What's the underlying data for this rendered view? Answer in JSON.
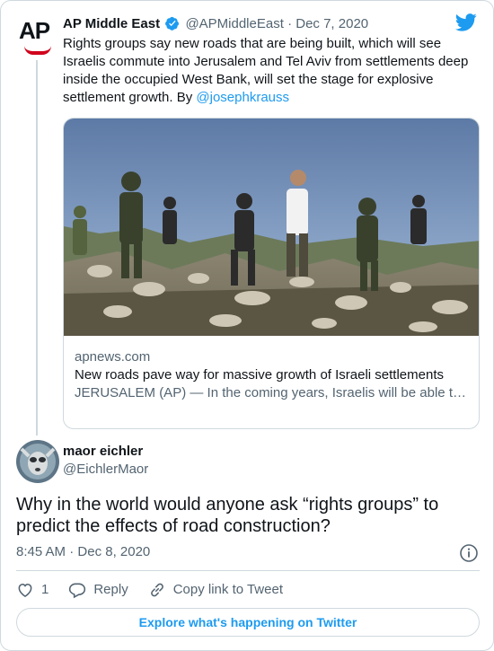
{
  "parent_tweet": {
    "display_name": "AP Middle East",
    "logo_text": "AP",
    "handle": "@APMiddleEast",
    "separator": "·",
    "date": "Dec 7, 2020",
    "text": "Rights groups say new roads that are being built, which will see Israelis commute into Jerusalem and Tel Aviv from settlements deep inside the occupied West Bank, will set the stage for explosive settlement growth. By ",
    "mention": "@josephkrauss",
    "link_card": {
      "domain": "apnews.com",
      "title": "New roads pave way for massive growth of Israeli settlements",
      "description": "JERUSALEM (AP) — In the coming years, Israelis will be able to commute into Jerusalem and Tel Aviv from settlements deep inside the occupied West Bank, will set the stage for explosive settlement growth."
    }
  },
  "tweet": {
    "display_name": "maor eichler",
    "handle": "@EichlerMaor",
    "text": "Why in the world would anyone ask “rights groups” to predict the effects of road construction?",
    "time": "8:45 AM",
    "separator": "·",
    "date": "Dec 8, 2020"
  },
  "actions": {
    "like_count": "1",
    "reply_label": "Reply",
    "copy_link_label": "Copy link to Tweet"
  },
  "footer": {
    "explore_label": "Explore what's happening on Twitter"
  },
  "icons": {
    "verified": "verified-badge-icon",
    "brand": "twitter-bird-icon",
    "info": "info-icon",
    "like": "heart-icon",
    "reply": "reply-bubble-icon",
    "copy_link": "link-icon"
  },
  "colors": {
    "accent": "#1d9bf0",
    "text": "#0f1419",
    "muted": "#536471",
    "border": "#cfd9de",
    "ap_red": "#d0021b"
  }
}
